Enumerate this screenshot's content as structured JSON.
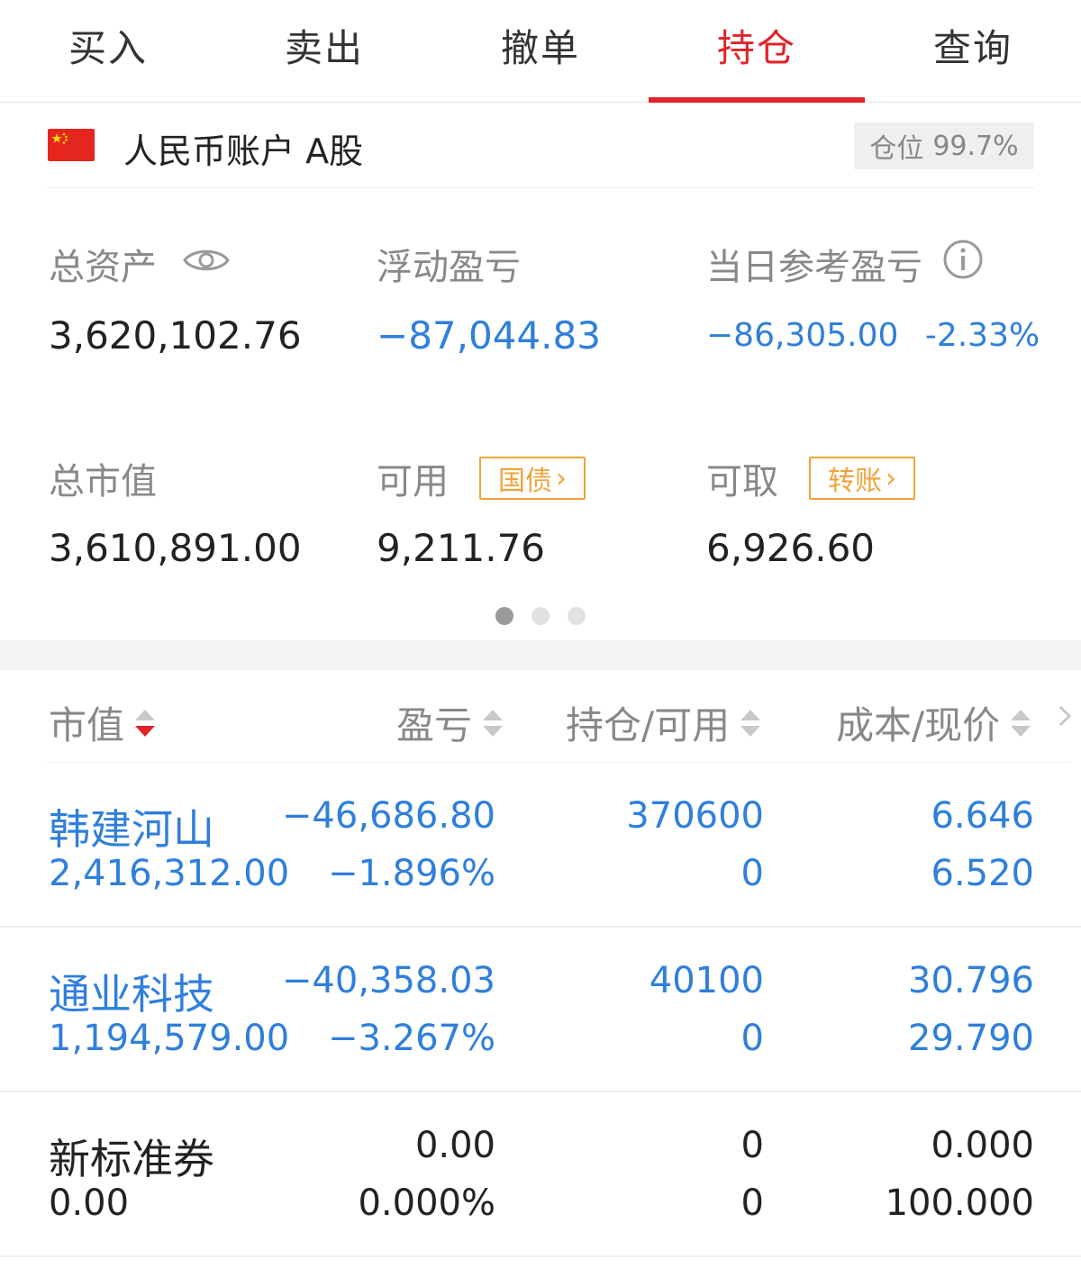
{
  "tabs": [
    {
      "label": "买入",
      "active": false
    },
    {
      "label": "卖出",
      "active": false
    },
    {
      "label": "撤单",
      "active": false
    },
    {
      "label": "持仓",
      "active": true
    },
    {
      "label": "查询",
      "active": false
    }
  ],
  "account": {
    "name": "人民币账户 A股",
    "position_label": "仓位",
    "position_value": "99.7%"
  },
  "summary": {
    "total_assets_label": "总资产",
    "total_assets": "3,620,102.76",
    "floating_pl_label": "浮动盈亏",
    "floating_pl": "−87,044.83",
    "daily_pl_label": "当日参考盈亏",
    "daily_pl": "−86,305.00",
    "daily_pl_pct": "-2.33%",
    "market_value_label": "总市值",
    "market_value": "3,610,891.00",
    "available_label": "可用",
    "available": "9,211.76",
    "available_btn": "国债",
    "withdrawable_label": "可取",
    "withdrawable": "6,926.60",
    "withdrawable_btn": "转账"
  },
  "pager": {
    "count": 3,
    "current": 0
  },
  "table": {
    "headers": [
      "市值",
      "盈亏",
      "持仓/可用",
      "成本/现价"
    ],
    "rows": [
      {
        "name": "韩建河山",
        "market_value": "2,416,312.00",
        "pl": "−46,686.80",
        "pl_pct": "−1.896%",
        "holding": "370600",
        "available": "0",
        "cost": "6.646",
        "price": "6.520",
        "tone": "blue"
      },
      {
        "name": "通业科技",
        "market_value": "1,194,579.00",
        "pl": "−40,358.03",
        "pl_pct": "−3.267%",
        "holding": "40100",
        "available": "0",
        "cost": "30.796",
        "price": "29.790",
        "tone": "blue"
      },
      {
        "name": "新标准券",
        "market_value": "0.00",
        "pl": "0.00",
        "pl_pct": "0.000%",
        "holding": "0",
        "available": "0",
        "cost": "0.000",
        "price": "100.000",
        "tone": "dark"
      }
    ]
  },
  "colors": {
    "accent": "#e0242a",
    "loss": "#2f7fdc",
    "button": "#f1a33a"
  }
}
